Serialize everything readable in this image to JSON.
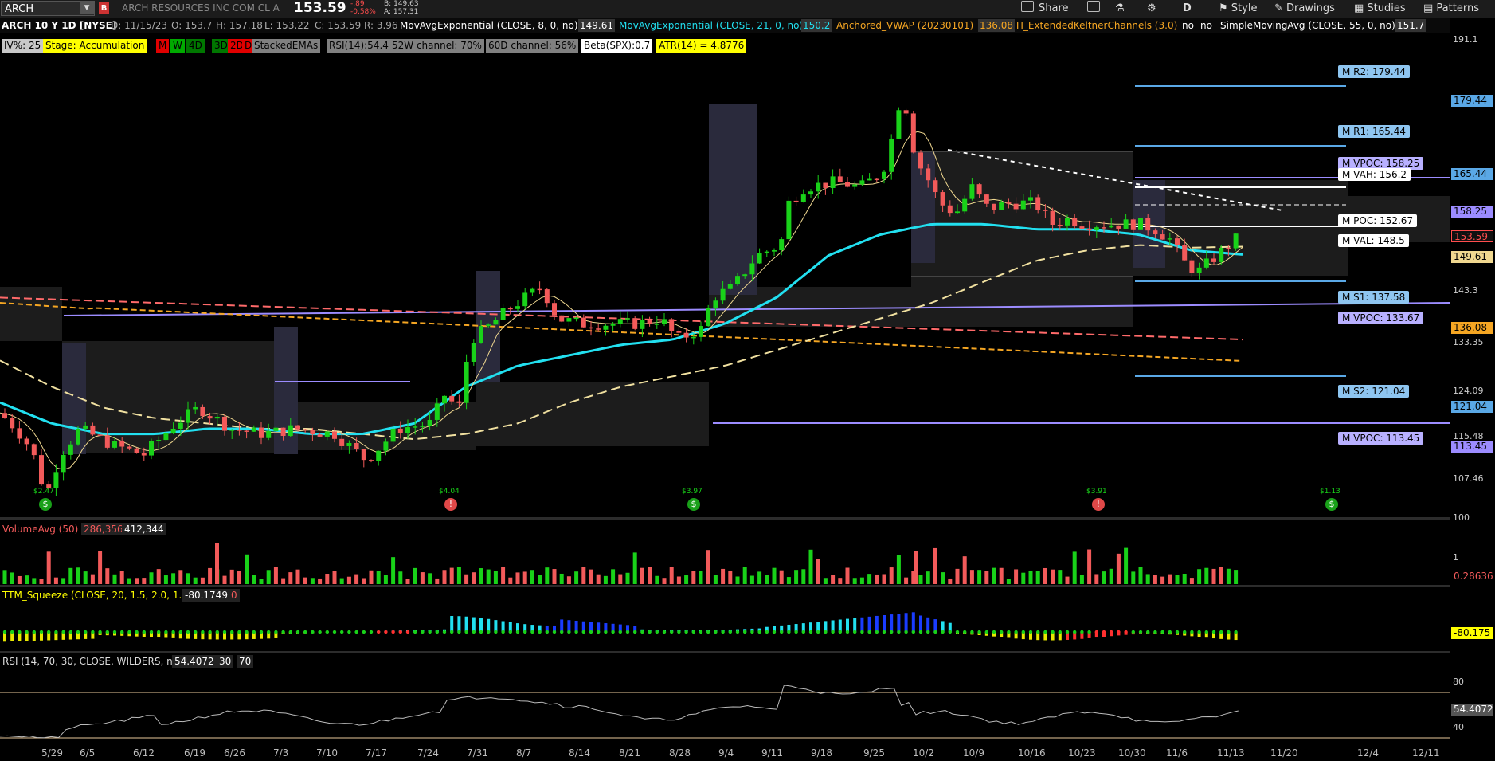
{
  "header": {
    "symbol": "ARCH",
    "company": "ARCH RESOURCES INC COM CL A",
    "last": "153.59",
    "change": "-.89",
    "change_pct": "-0.58%",
    "bid": "B: 149.63",
    "ask": "A: 157.31",
    "toolbar": {
      "share": "Share",
      "style": "Style",
      "drawings": "Drawings",
      "studies": "Studies",
      "patterns": "Patterns",
      "period": "D"
    }
  },
  "studies_row": {
    "title": "ARCH 10 Y 1D [NYSE]",
    "date": "D: 11/15/23",
    "open": "O: 153.7",
    "high": "H: 157.18",
    "low": "L: 153.22",
    "close": "C: 153.59",
    "range": "R: 3.96",
    "ema8_label": "MovAvgExponential (CLOSE, 8, 0, no)",
    "ema8_value": "149.61",
    "ema21_label": "MovAvgExponential (CLOSE, 21, 0, no)",
    "ema21_value": "150.2",
    "vwap_label": "Anchored_VWAP (20230101)",
    "vwap_value": "136.08",
    "keltner_label": "TI_ExtendedKeltnerChannels (3.0)",
    "keltner_v1": "no",
    "keltner_v2": "no",
    "sma55_label": "SimpleMovingAvg (CLOSE, 55, 0, no)",
    "sma55_value": "151.7"
  },
  "chips": [
    {
      "text": "IV%: 25",
      "bg": "#c8c8c8",
      "fg": "#000"
    },
    {
      "text": "Stage: Accumulation",
      "bg": "#ffff00",
      "fg": "#000"
    },
    {
      "text": "M",
      "bg": "#e00000",
      "fg": "#000"
    },
    {
      "text": "W",
      "bg": "#00aa00",
      "fg": "#000"
    },
    {
      "text": "4D",
      "bg": "#007700",
      "fg": "#000"
    },
    {
      "text": "3D",
      "bg": "#007700",
      "fg": "#000"
    },
    {
      "text": "2D",
      "bg": "#e00000",
      "fg": "#000"
    },
    {
      "text": "D",
      "bg": "#e00000",
      "fg": "#000"
    },
    {
      "text": "StackedEMAs",
      "bg": "#808080",
      "fg": "#000"
    },
    {
      "text": "RSI(14):54.4",
      "bg": "#808080",
      "fg": "#000"
    },
    {
      "text": "52W channel: 70%",
      "bg": "#808080",
      "fg": "#000"
    },
    {
      "text": "60D channel: 56%",
      "bg": "#808080",
      "fg": "#000"
    },
    {
      "text": "Beta(SPX):0.7",
      "bg": "#ffffff",
      "fg": "#000"
    },
    {
      "text": "ATR(14) = 4.8776",
      "bg": "#ffff00",
      "fg": "#000"
    }
  ],
  "price_axis": [
    "191.1",
    "179.44",
    "165.44",
    "158.25",
    "153.59",
    "149.61",
    "143.3",
    "136.08",
    "133.35",
    "124.09",
    "121.04",
    "115.48",
    "113.45",
    "107.46",
    "100"
  ],
  "levels": {
    "r2": "M R2: 179.44",
    "r1": "M R1: 165.44",
    "vpoc_top": "M VPOC: 158.25",
    "vah": "M VAH: 156.2",
    "poc": "M POC: 152.67",
    "val": "M VAL: 148.5",
    "s1": "M S1: 137.58",
    "vpoc_mid": "M VPOC: 133.67",
    "s2": "M S2: 121.04",
    "vpoc_low": "M VPOC: 113.45"
  },
  "dividends": [
    "$2.47",
    "$4.04",
    "$3.97",
    "$3.91",
    "$1.13"
  ],
  "x_axis": [
    "5/29",
    "6/5",
    "6/12",
    "6/19",
    "6/26",
    "7/3",
    "7/10",
    "7/17",
    "7/24",
    "7/31",
    "8/7",
    "8/14",
    "8/21",
    "8/28",
    "9/4",
    "9/11",
    "9/18",
    "9/25",
    "10/2",
    "10/9",
    "10/16",
    "10/23",
    "10/30",
    "11/6",
    "11/13",
    "11/20",
    "12/4",
    "12/11"
  ],
  "volume": {
    "label": "VolumeAvg (50)",
    "v1": "286,356",
    "v2": "412,344",
    "axis_top": "1",
    "tag": "0.28636"
  },
  "ttm": {
    "label": "TTM_Squeeze (CLOSE, 20, 1.5, 2.0, 1.0)",
    "v1": "-80.1749",
    "v2": "0",
    "tag": "-80.175"
  },
  "rsi": {
    "label": "RSI (14, 70, 30, CLOSE, WILDERS, no)",
    "v1": "54.4072",
    "v2": "30",
    "v3": "70",
    "axis_top": "80",
    "axis_bottom": "40",
    "tag": "54.4072"
  },
  "colors": {
    "up": "#19d219",
    "down": "#f25a5a",
    "ema8": "#f0d890",
    "ema21": "#22e0f0",
    "sma55": "#f0e0a0",
    "vwap": "#f5a623",
    "pivot": "#5aa8e6",
    "vpoc": "#9c8cff"
  },
  "chart_data": {
    "type": "line",
    "title": "ARCH 10 Y 1D [NYSE]",
    "x_ticks": [
      "5/29",
      "6/5",
      "6/12",
      "6/19",
      "6/26",
      "7/3",
      "7/10",
      "7/17",
      "7/24",
      "7/31",
      "8/7",
      "8/14",
      "8/21",
      "8/28",
      "9/4",
      "9/11",
      "9/18",
      "9/25",
      "10/2",
      "10/9",
      "10/16",
      "10/23",
      "10/30",
      "11/6",
      "11/13",
      "11/20",
      "12/4",
      "12/11"
    ],
    "ylim": [
      100,
      191.1
    ],
    "series": [
      {
        "name": "MovAvgExponential (CLOSE, 21, 0, no)",
        "values": [
          122,
          118,
          116,
          116,
          117,
          117,
          116,
          116,
          118,
          125,
          129,
          131,
          133,
          134,
          137,
          142,
          150,
          154,
          156,
          156,
          155,
          155,
          154,
          151,
          150.2
        ]
      },
      {
        "name": "SimpleMovingAvg (CLOSE, 55, 0, no)",
        "values": [
          130,
          125,
          121,
          119,
          118,
          117,
          117,
          116,
          115,
          116,
          118,
          122,
          125,
          127,
          129,
          132,
          135,
          138,
          141,
          145,
          149,
          151,
          152,
          151.5,
          151.7
        ]
      }
    ]
  }
}
